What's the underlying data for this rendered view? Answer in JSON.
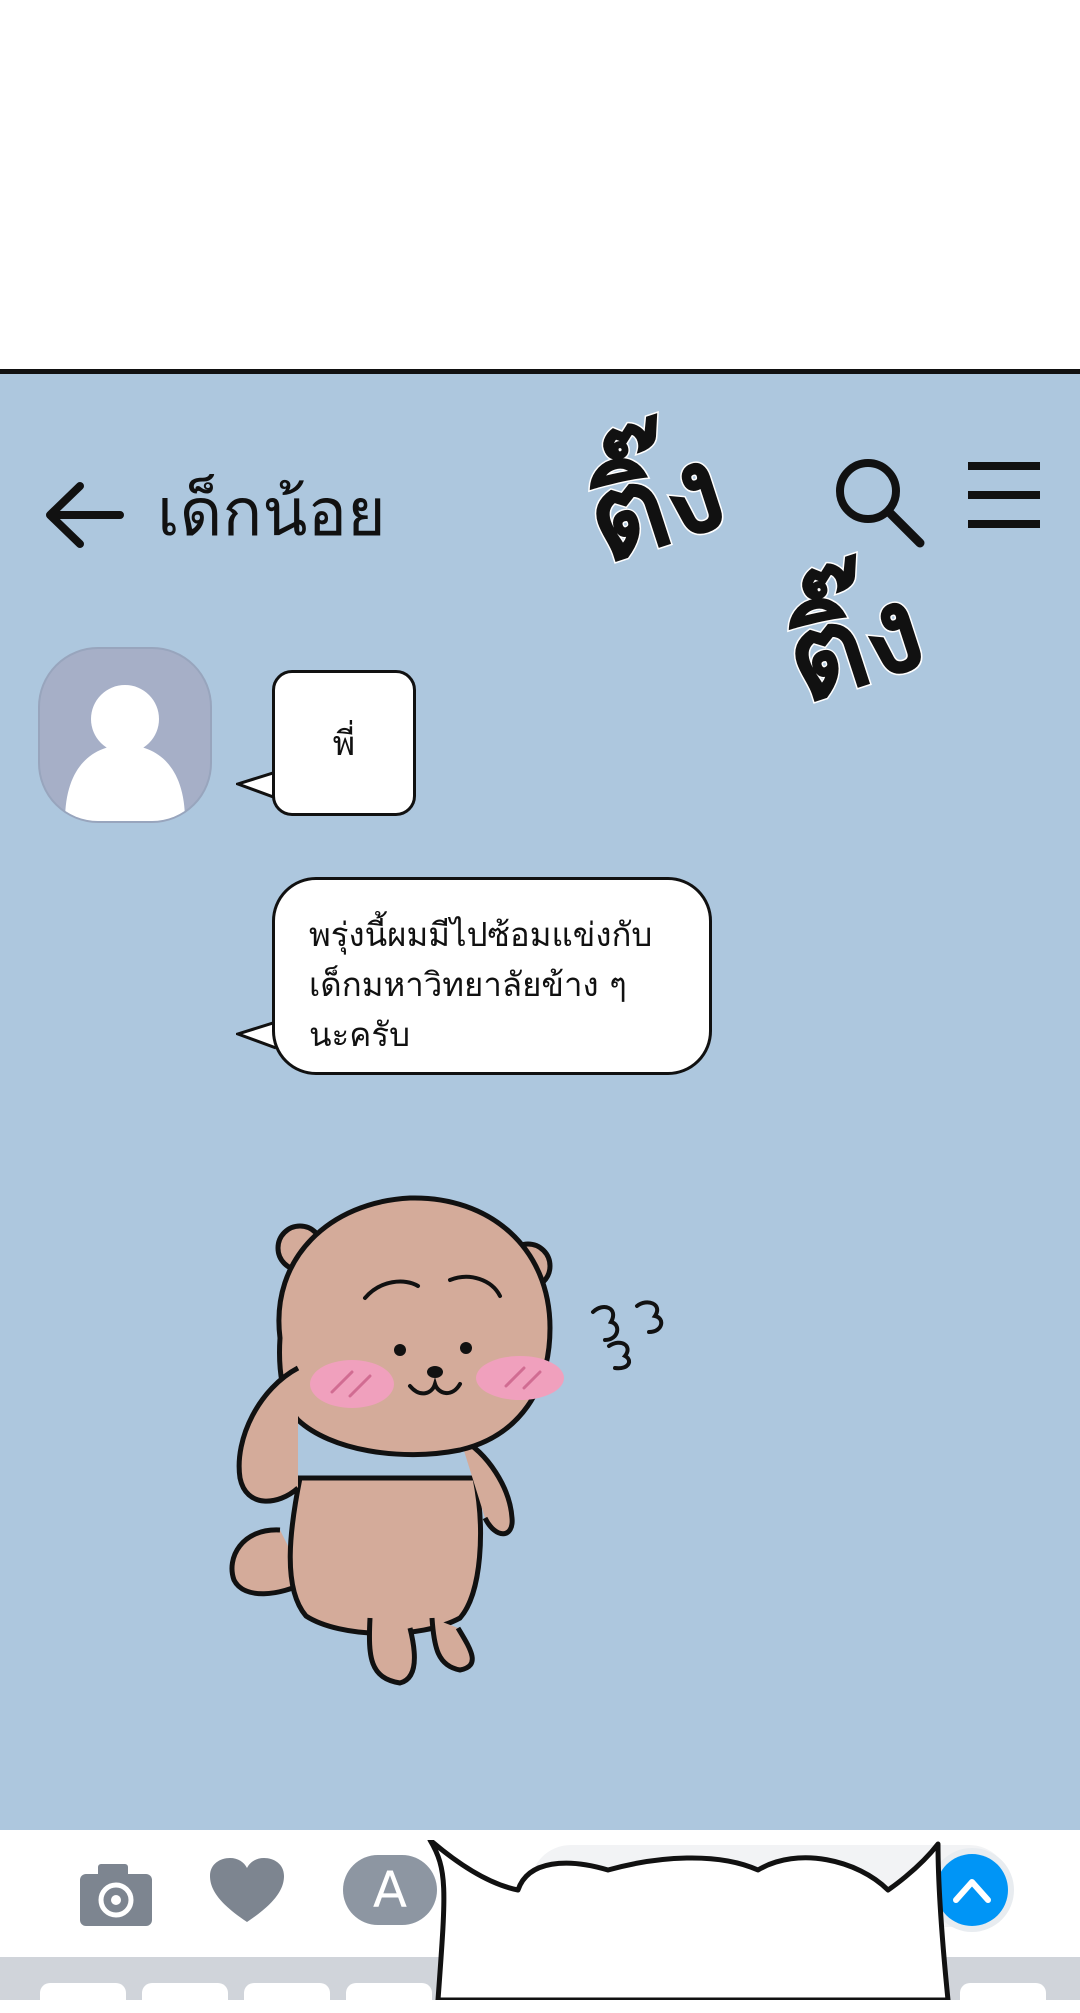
{
  "header": {
    "title": "เด็กน้อย",
    "back_icon": "arrow-left-icon",
    "search_icon": "search-icon",
    "menu_icon": "hamburger-menu-icon"
  },
  "sound_effects": [
    "ติ๊ง",
    "ติ๊ง"
  ],
  "messages": [
    {
      "sender": "contact",
      "text": "พี่"
    },
    {
      "sender": "contact",
      "lines": [
        "พรุ่งนี้ผมมีไปซ้อมแข่งกับ",
        "เด็กมหาวิทยาลัยข้าง ๆ",
        "นะครับ"
      ]
    }
  ],
  "sticker": {
    "name": "blushing-bear-sticker"
  },
  "composer": {
    "camera_icon": "camera-icon",
    "heart_icon": "heart-icon",
    "text_toggle_label": "A",
    "send_icon": "chevron-up-icon"
  },
  "colors": {
    "chat_background": "#adc7de",
    "avatar": "#a6afc7",
    "send_button": "#0095f6",
    "text_toggle": "#8d96a2",
    "bear_fur": "#d4ab9a",
    "bear_blush": "#f0a0bd"
  }
}
